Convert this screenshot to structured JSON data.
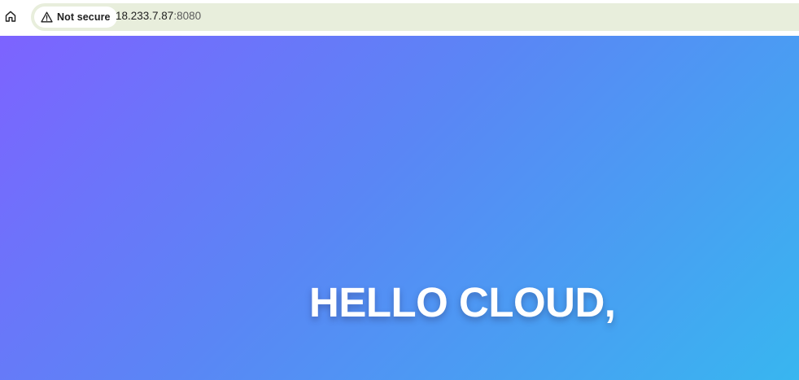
{
  "browser": {
    "home_icon": "home-icon",
    "security": {
      "icon": "warning-triangle-icon",
      "label": "Not secure"
    },
    "url": {
      "host": "18.233.7.87",
      "port": ":8080"
    }
  },
  "page": {
    "headline": "HELLO CLOUD,",
    "colors": {
      "gradient_start": "#7d63ff",
      "gradient_mid": "#5a86f5",
      "gradient_end": "#38b6f0",
      "text": "#ffffff"
    }
  }
}
